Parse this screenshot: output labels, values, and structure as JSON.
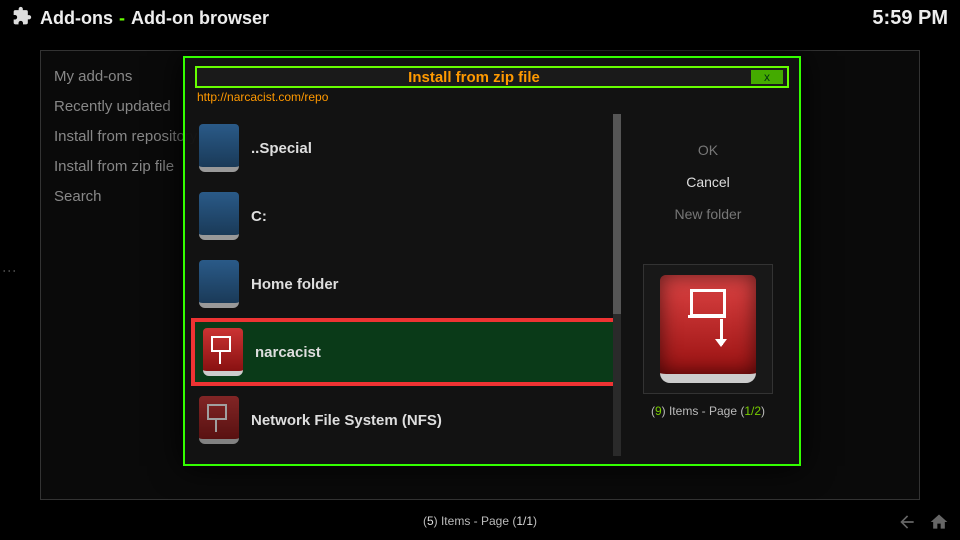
{
  "header": {
    "section": "Add-ons",
    "page": "Add-on browser",
    "time": "5:59 PM"
  },
  "sidebar": {
    "items": [
      {
        "label": "My add-ons"
      },
      {
        "label": "Recently updated"
      },
      {
        "label": "Install from repository"
      },
      {
        "label": "Install from zip file"
      },
      {
        "label": "Search"
      }
    ]
  },
  "modal": {
    "title": "Install from zip file",
    "close_label": "x",
    "path": "http://narcacist.com/repo",
    "buttons": {
      "ok": "OK",
      "cancel": "Cancel",
      "new_folder": "New folder"
    },
    "files": [
      {
        "label": "..Special",
        "icon": "blue"
      },
      {
        "label": "C:",
        "icon": "blue"
      },
      {
        "label": "Home folder",
        "icon": "blue"
      },
      {
        "label": "narcacist",
        "icon": "red",
        "selected": true
      },
      {
        "label": "Network File System (NFS)",
        "icon": "red-dim"
      }
    ],
    "status": {
      "count": "9",
      "text": " Items - Page (",
      "page": "1/2",
      "tail": ")"
    }
  },
  "footer": {
    "count": "5",
    "text": " Items - Page (",
    "page": "1/1",
    "tail": ")"
  }
}
